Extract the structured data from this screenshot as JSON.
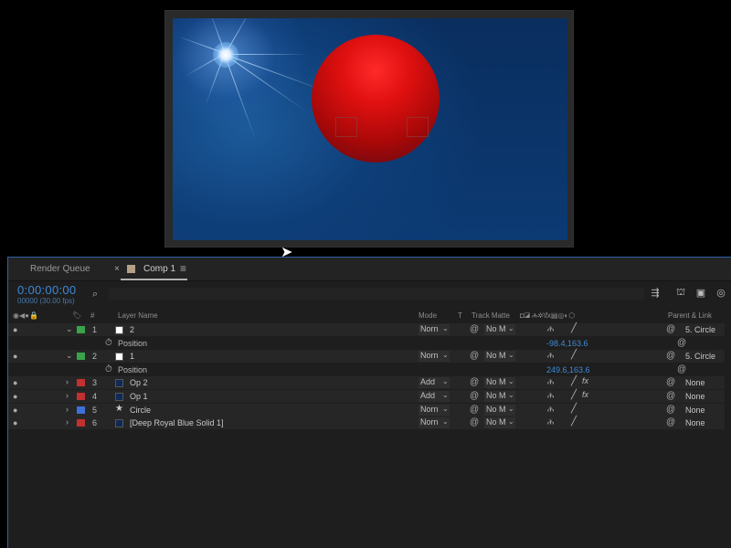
{
  "tabs": {
    "render_queue": "Render Queue",
    "close": "×",
    "comp": "Comp 1",
    "menu": "≡"
  },
  "time": {
    "current": "0:00:00:00",
    "frames_fps": "00000 (30.00 fps)"
  },
  "columns": {
    "layer_name": "Layer Name",
    "mode": "Mode",
    "t": "T",
    "track_matte": "Track Matte",
    "parent_link": "Parent & Link",
    "hash": "#"
  },
  "icons": {
    "search": "⌕",
    "eye": "●",
    "twirl_open": "⌄",
    "twirl_closed": "›",
    "stopwatch": "⏱",
    "star": "★",
    "spiral": "@",
    "puppet": "ሕ",
    "caret": "⌄"
  },
  "layers": [
    {
      "num": "1",
      "name": "2",
      "label_color": "#3aa34a",
      "icon_color": "#ffffff",
      "expanded": true,
      "mode": "Norn",
      "matte": "No M",
      "fx": false,
      "parent": "5. Circle",
      "prop": {
        "name": "Position",
        "value": "-98.4,163.6"
      }
    },
    {
      "num": "2",
      "name": "1",
      "label_color": "#3aa34a",
      "icon_color": "#ffffff",
      "expanded": true,
      "mode": "Norn",
      "matte": "No M",
      "fx": false,
      "parent": "5. Circle",
      "prop": {
        "name": "Position",
        "value": "249.6,163.6"
      }
    },
    {
      "num": "3",
      "name": "Op 2",
      "label_color": "#c23030",
      "icon_color": "#0f2a55",
      "expanded": false,
      "mode": "Add",
      "matte": "No M",
      "fx": true,
      "parent": "None"
    },
    {
      "num": "4",
      "name": "Op 1",
      "label_color": "#c23030",
      "icon_color": "#0f2a55",
      "expanded": false,
      "mode": "Add",
      "matte": "No M",
      "fx": true,
      "parent": "None"
    },
    {
      "num": "5",
      "name": "Circle",
      "label_color": "#3f6fd8",
      "icon_color": "star",
      "expanded": false,
      "mode": "Norn",
      "matte": "No M",
      "fx": false,
      "parent": "None"
    },
    {
      "num": "6",
      "name": "[Deep Royal Blue Solid 1]",
      "label_color": "#c23030",
      "icon_color": "#0f2a55",
      "expanded": false,
      "mode": "Norn",
      "matte": "No M",
      "fx": false,
      "parent": "None"
    }
  ],
  "colors": {
    "accent_blue": "#3d8ad8",
    "panel_bg": "#1e1e1e",
    "sphere_red": "#e01010",
    "comp_bg": "#0b356b"
  }
}
